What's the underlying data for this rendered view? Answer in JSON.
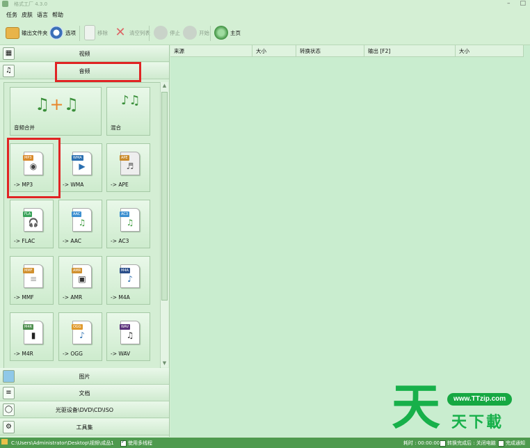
{
  "window": {
    "title": "格式工厂 4.3.0",
    "minimize": "–",
    "close": "□"
  },
  "menu": [
    "任务",
    "皮肤",
    "语言",
    "帮助"
  ],
  "toolbar": {
    "output_folder": "输出文件夹",
    "options": "选项",
    "remove": "移除",
    "clear_list": "清空列表",
    "stop": "停止",
    "start": "开始",
    "home": "主页"
  },
  "categories": {
    "video": "视频",
    "audio": "音频",
    "picture": "图片",
    "document": "文档",
    "optical": "光驱设备\\DVD\\CD\\ISO",
    "tools": "工具集"
  },
  "audio_tiles": [
    {
      "label": "音频合并"
    },
    {
      "label": "混合"
    },
    {
      "label": "-> MP3",
      "badge": "MP3",
      "badge_color": "#d98a2b",
      "glyph": "◉"
    },
    {
      "label": "-> WMA",
      "badge": "WMA",
      "badge_color": "#2a6fb0",
      "glyph": "▶"
    },
    {
      "label": "-> APE",
      "badge": "APE",
      "badge_color": "#c98a2a",
      "glyph": "♬"
    },
    {
      "label": "-> FLAC",
      "badge": "FLA",
      "badge_color": "#3aa35a",
      "glyph": "🎧"
    },
    {
      "label": "-> AAC",
      "badge": "AAC",
      "badge_color": "#3c8fd0",
      "glyph": "♫"
    },
    {
      "label": "-> AC3",
      "badge": "AC3",
      "badge_color": "#3c8fd0",
      "glyph": "♫"
    },
    {
      "label": "-> MMF",
      "badge": "MMF",
      "badge_color": "#d0902e",
      "glyph": "≡"
    },
    {
      "label": "-> AMR",
      "badge": "AMR",
      "badge_color": "#d0902e",
      "glyph": "▣"
    },
    {
      "label": "-> M4A",
      "badge": "M4A",
      "badge_color": "#2c4f8a",
      "glyph": "♪"
    },
    {
      "label": "-> M4R",
      "badge": "M4R",
      "badge_color": "#4f8f4f",
      "glyph": "▮"
    },
    {
      "label": "-> OGG",
      "badge": "OGG",
      "badge_color": "#e09a2c",
      "glyph": "♪"
    },
    {
      "label": "-> WAV",
      "badge": "WAV",
      "badge_color": "#5a2f7a",
      "glyph": "♫"
    }
  ],
  "columns": [
    "来源",
    "大小",
    "转换状态",
    "输出 [F2]",
    "大小"
  ],
  "status": {
    "output_path": "C:\\Users\\Administrator\\Desktop\\视频\\成品1",
    "multithread": "使用多线程",
    "elapsed": "耗时 : 00:00:00",
    "after_convert": "转换完成后 : 关闭电脑",
    "notify": "完成通知"
  },
  "watermark": {
    "big": "天",
    "url": "www.TTzip.com",
    "sub": "天下載"
  },
  "colors": {
    "accent_green": "#4e9a4e",
    "highlight_red": "#e02424",
    "watermark_green": "#17b04a"
  }
}
